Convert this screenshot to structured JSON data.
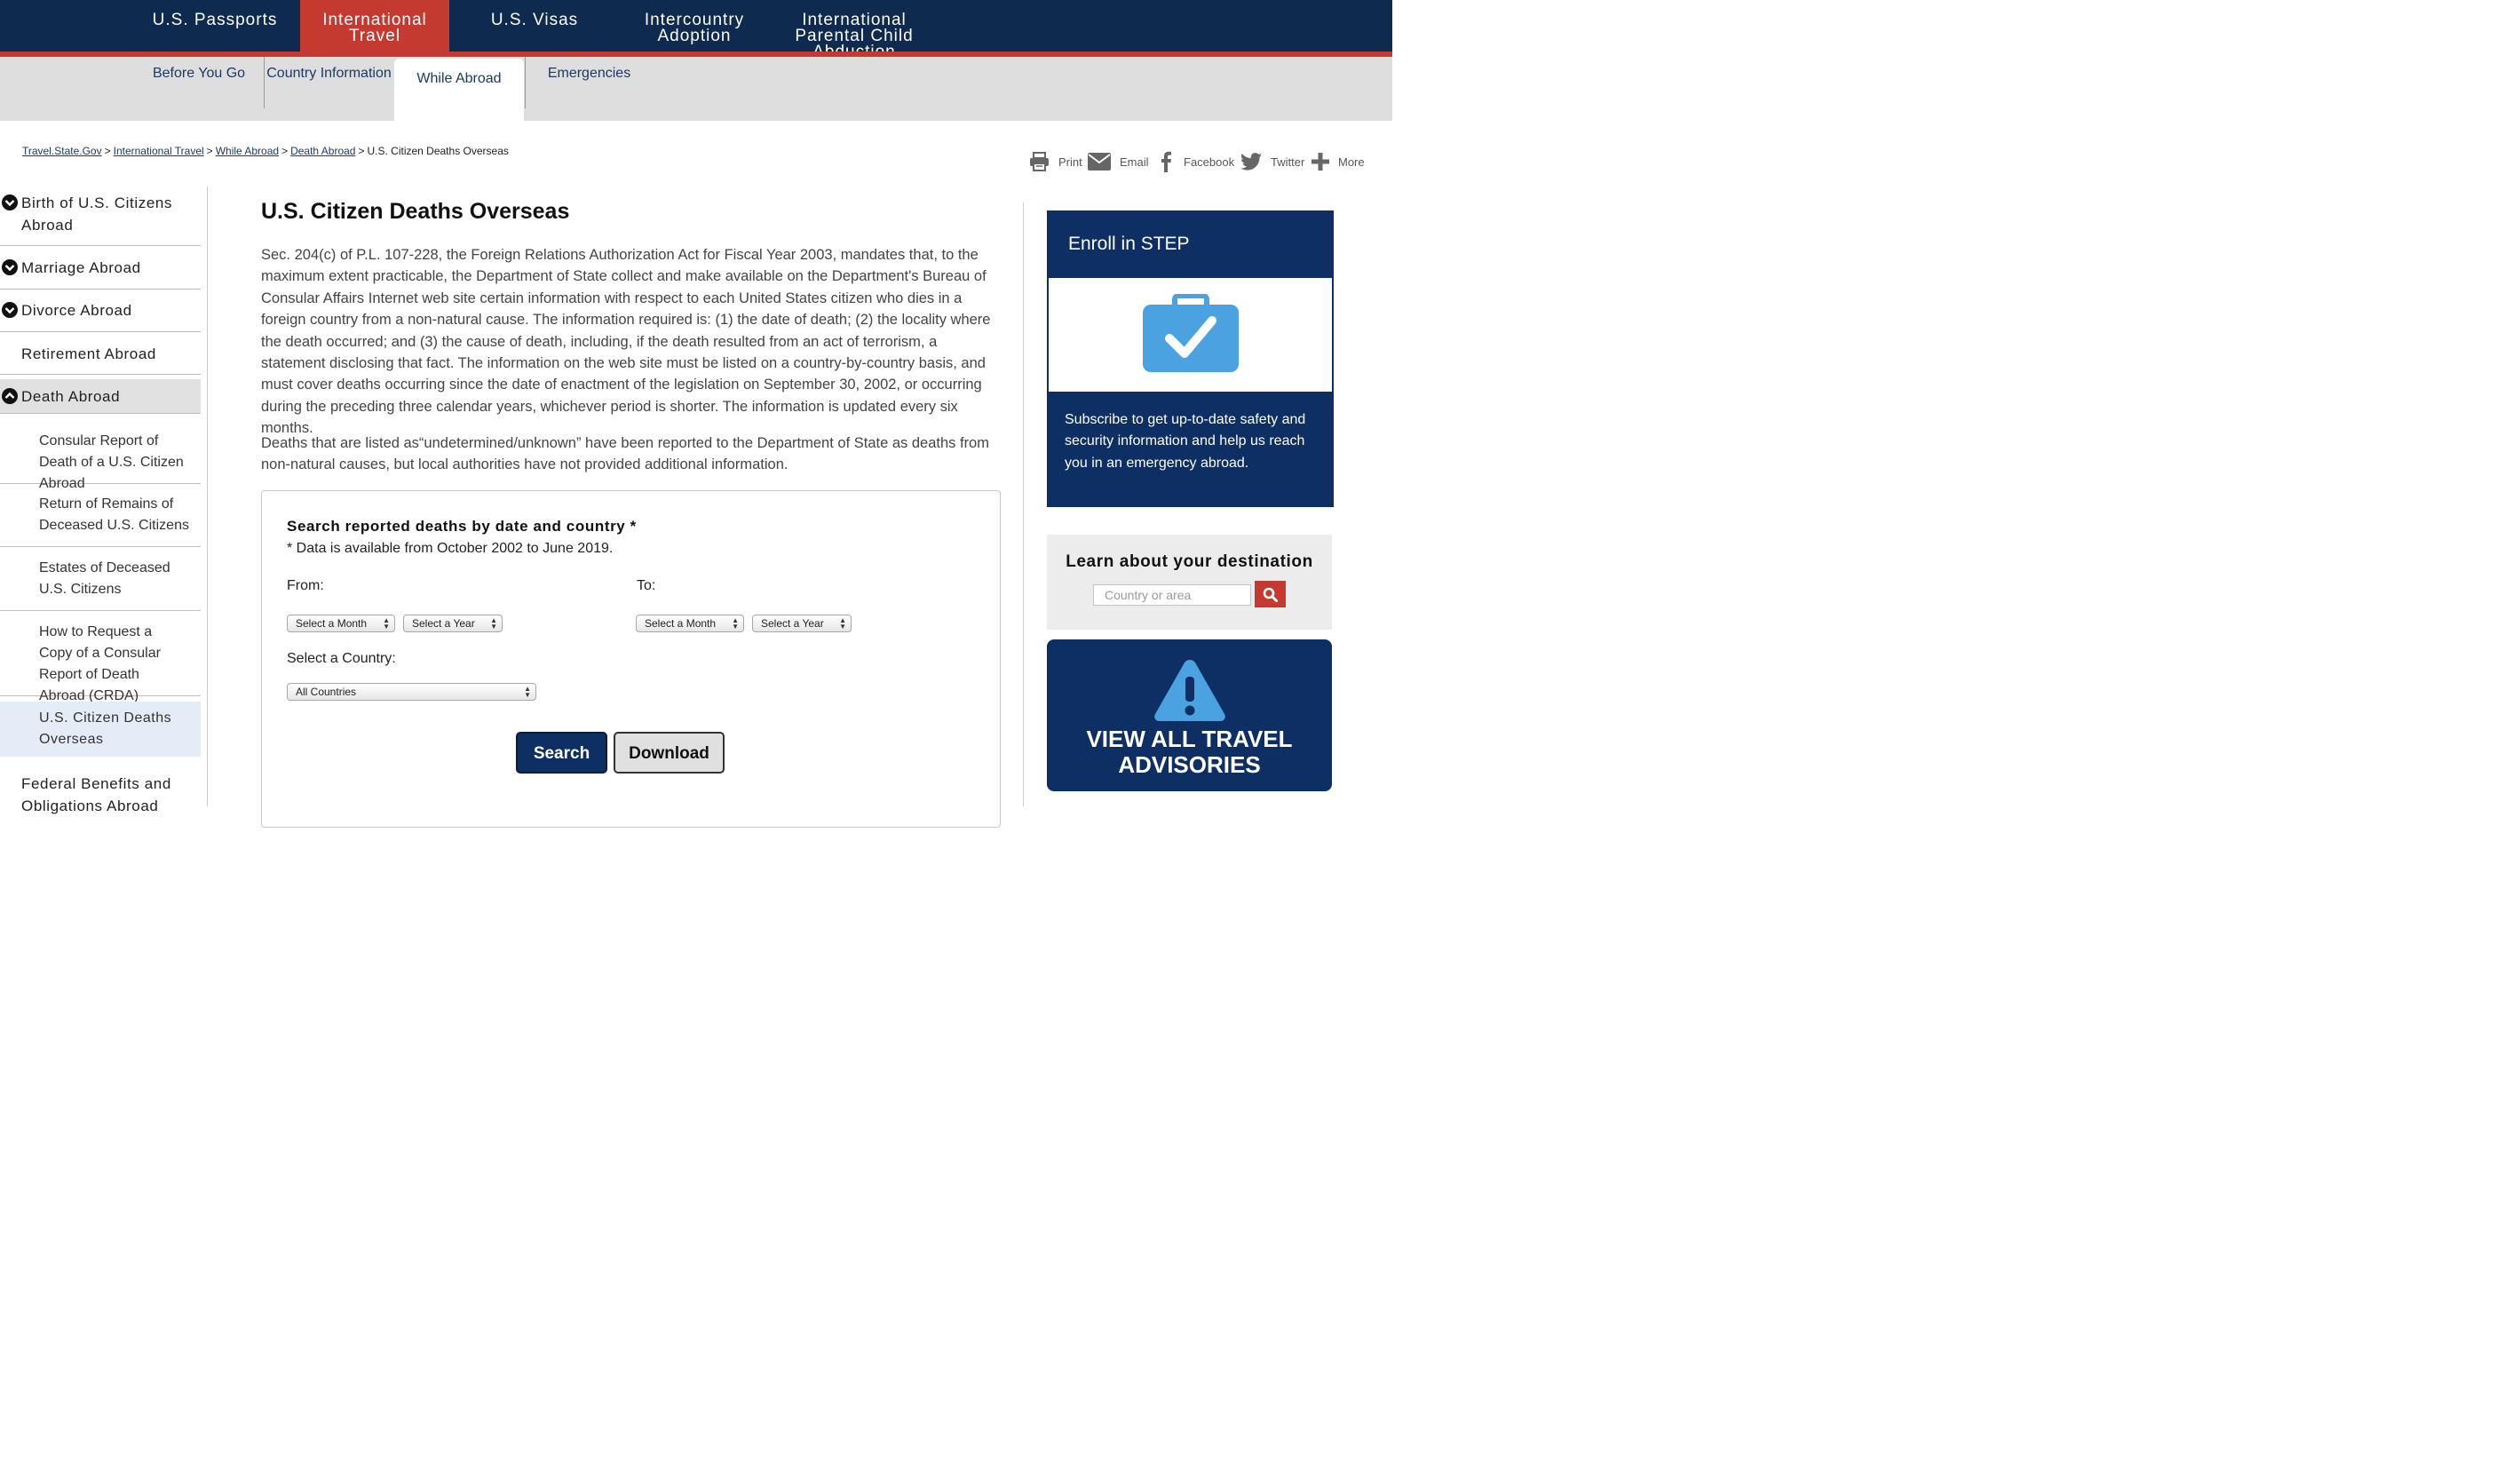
{
  "top_nav": {
    "items": [
      {
        "label_line1": "U.S. Passports",
        "label_line2": ""
      },
      {
        "label_line1": "International",
        "label_line2": "Travel"
      },
      {
        "label_line1": "U.S. Visas",
        "label_line2": ""
      },
      {
        "label_line1": "Intercountry",
        "label_line2": "Adoption"
      },
      {
        "label_line1": "International",
        "label_line2": "Parental Child",
        "label_line3": "Abduction"
      }
    ],
    "active_color": "#c43a31",
    "bg_color": "#0e2a4f"
  },
  "sub_nav": {
    "items": [
      {
        "label": "Before You Go"
      },
      {
        "label": "Country Information"
      },
      {
        "label": "While Abroad"
      },
      {
        "label": "Emergencies"
      }
    ],
    "active": "While Abroad"
  },
  "breadcrumb": {
    "links": [
      "Travel.State.Gov",
      "International Travel",
      "While Abroad",
      "Death Abroad"
    ],
    "current": "U.S. Citizen Deaths Overseas"
  },
  "share": {
    "print": "Print",
    "email": "Email",
    "facebook": "Facebook",
    "twitter": "Twitter",
    "more": "More"
  },
  "sidebar": {
    "birth": "Birth of U.S. Citizens Abroad",
    "marriage": "Marriage Abroad",
    "divorce": "Divorce Abroad",
    "retirement": "Retirement Abroad",
    "death": "Death Abroad",
    "sub": {
      "consular_report": "Consular Report of Death of a U.S. Citizen Abroad",
      "return_remains": "Return of Remains of Deceased U.S. Citizens",
      "estates": "Estates of Deceased U.S. Citizens",
      "request_copy": "How to Request a Copy of a Consular Report of Death Abroad (CRDA)",
      "deaths_overseas": "U.S. Citizen Deaths Overseas"
    },
    "federal_benefits": "Federal Benefits and Obligations Abroad"
  },
  "main": {
    "title": "U.S. Citizen Deaths Overseas",
    "para1": "Sec. 204(c) of P.L. 107-228, the Foreign Relations Authorization Act for Fiscal Year 2003, mandates that, to the maximum extent practicable, the Department of State collect and make available on the Department's Bureau of Consular Affairs Internet web site certain information with respect to each United States citizen who dies in a foreign country from a non-natural cause. The information required is: (1) the date of death; (2) the locality where the death occurred; and (3) the cause of death, including, if the death resulted from an act of terrorism, a statement disclosing that fact. The information on the web site must be listed on a country-by-country basis, and must cover deaths occurring since the date of enactment of the legislation on September 30, 2002, or occurring during the preceding three calendar years, whichever period is shorter. The information is updated every six months.",
    "para2": "Deaths that are listed as“undetermined/unknown” have been reported to the Department of State as deaths from non-natural causes, but local authorities have not provided additional information."
  },
  "search_form": {
    "title": "Search reported deaths by date and country *",
    "note": "* Data is available from October 2002 to June 2019.",
    "from_label": "From:",
    "to_label": "To:",
    "from_month": "Select a Month",
    "from_year": "Select a Year",
    "to_month": "Select a Month",
    "to_year": "Select a Year",
    "country_label": "Select a Country:",
    "country_value": "All Countries",
    "search_button": "Search",
    "download_button": "Download"
  },
  "right": {
    "step_title": "Enroll in STEP",
    "step_text": "Subscribe to get up-to-date safety and security information and help us reach you in an emergency abroad.",
    "learn_title": "Learn about your destination",
    "learn_placeholder": "Country or area",
    "advisories_line1": "VIEW ALL TRAVEL",
    "advisories_line2": "ADVISORIES",
    "accent_blue": "#0e2f63",
    "icon_blue": "#4aa3e0"
  }
}
